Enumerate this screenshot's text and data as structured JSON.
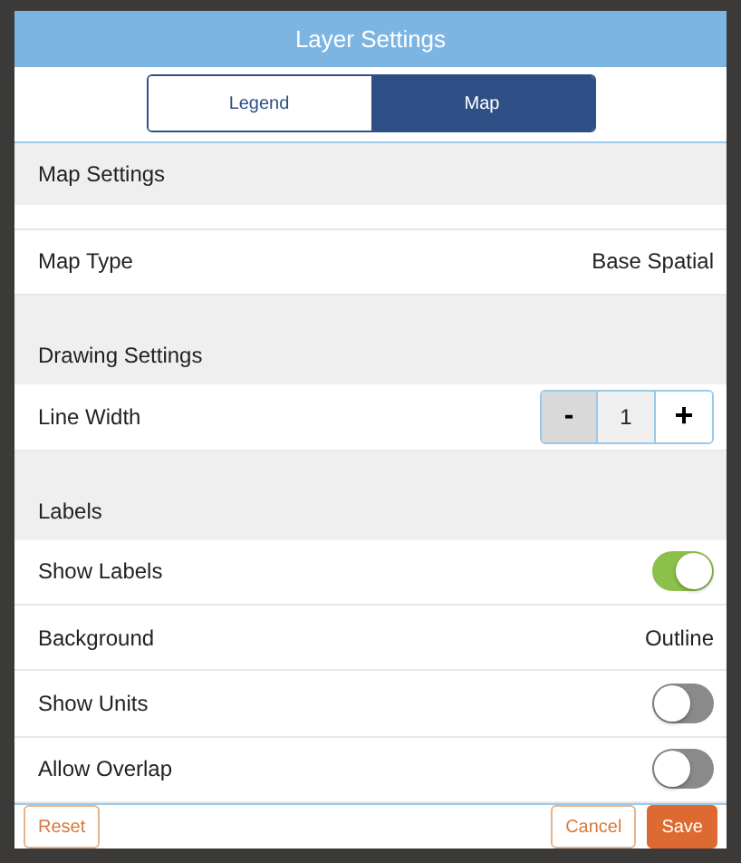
{
  "window": {
    "title": "Layer Settings"
  },
  "tabs": [
    {
      "label": "Legend",
      "selected": false
    },
    {
      "label": "Map",
      "selected": true
    }
  ],
  "sections": [
    {
      "title": "Map Settings",
      "clipped_row": true,
      "rows": [
        {
          "kind": "value",
          "label": "Map Type",
          "value": "Base Spatial"
        }
      ]
    },
    {
      "title": "Drawing Settings",
      "rows": [
        {
          "kind": "stepper",
          "label": "Line Width",
          "minus": "-",
          "value": "1",
          "plus": "+"
        }
      ]
    },
    {
      "title": "Labels",
      "rows": [
        {
          "kind": "toggle",
          "label": "Show Labels",
          "on": true
        },
        {
          "kind": "value",
          "label": "Background",
          "value": "Outline"
        },
        {
          "kind": "toggle",
          "label": "Show Units",
          "on": false
        },
        {
          "kind": "toggle",
          "label": "Allow Overlap",
          "on": false
        }
      ]
    }
  ],
  "footer": {
    "reset": "Reset",
    "cancel": "Cancel",
    "save": "Save"
  }
}
